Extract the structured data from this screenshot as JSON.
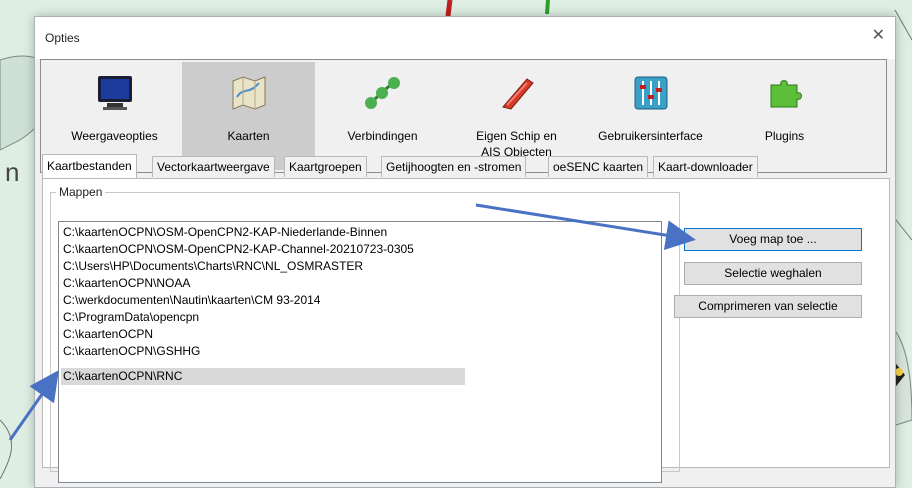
{
  "window": {
    "title": "Opties",
    "close_glyph": "✕"
  },
  "background": {
    "partial_text": "n"
  },
  "toolbar": {
    "items": [
      {
        "label": "Weergaveopties",
        "icon": "monitor-icon",
        "selected": false
      },
      {
        "label": "Kaarten",
        "icon": "map-icon",
        "selected": true
      },
      {
        "label": "Verbindingen",
        "icon": "connections-icon",
        "selected": false
      },
      {
        "label": "Eigen Schip en\nAIS Objecten",
        "icon": "ship-icon",
        "selected": false
      },
      {
        "label": "Gebruikersinterface",
        "icon": "sliders-icon",
        "selected": false
      },
      {
        "label": "Plugins",
        "icon": "puzzle-icon",
        "selected": false
      }
    ]
  },
  "tabs": [
    {
      "label": "Kaartbestanden",
      "active": true
    },
    {
      "label": "Vectorkaartweergave",
      "active": false
    },
    {
      "label": "Kaartgroepen",
      "active": false
    },
    {
      "label": "Getijhoogten en -stromen",
      "active": false
    },
    {
      "label": "oeSENC kaarten",
      "active": false
    },
    {
      "label": "Kaart-downloader",
      "active": false
    }
  ],
  "folders": {
    "label": "Mappen",
    "items": [
      "C:\\kaartenOCPN\\OSM-OpenCPN2-KAP-Niederlande-Binnen",
      "C:\\kaartenOCPN\\OSM-OpenCPN2-KAP-Channel-20210723-0305",
      "C:\\Users\\HP\\Documents\\Charts\\RNC\\NL_OSMRASTER",
      "C:\\kaartenOCPN\\NOAA",
      "C:\\werkdocumenten\\Nautin\\kaarten\\CM 93-2014",
      "C:\\ProgramData\\opencpn",
      "C:\\kaartenOCPN",
      "C:\\kaartenOCPN\\GSHHG",
      "C:\\kaartenOCPN\\RNC"
    ],
    "selected_index": 8
  },
  "buttons": {
    "add": "Voeg map toe ...",
    "remove": "Selectie weghalen",
    "compress": "Comprimeren van selectie"
  },
  "colors": {
    "arrow": "#4a72c4",
    "chart_sea": "#dfeee3",
    "dialog_bg": "#f0f0f0",
    "selected_tool": "#cccccc",
    "focus_border": "#0078d7"
  }
}
